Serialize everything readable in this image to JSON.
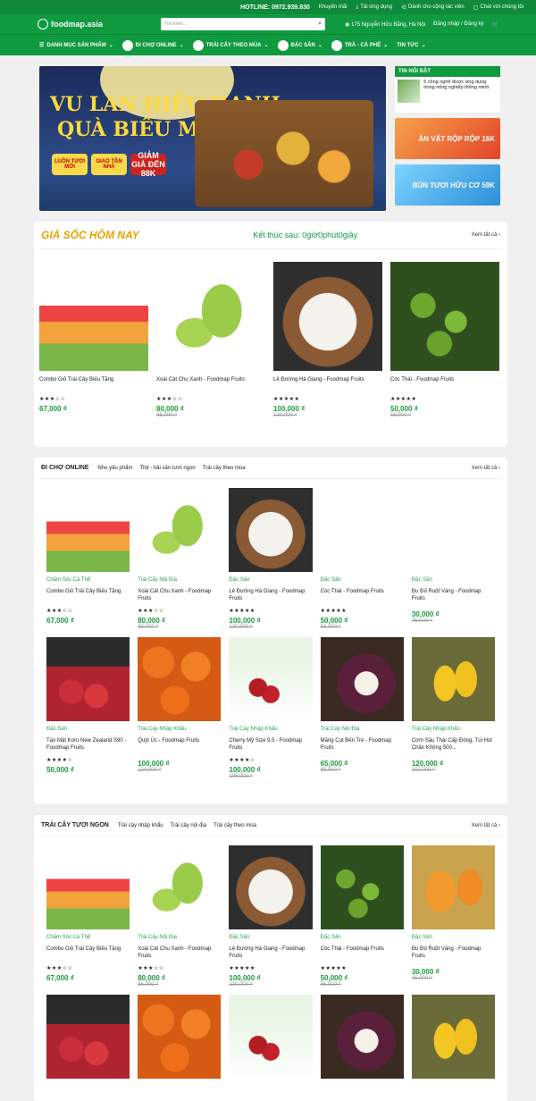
{
  "topbar": {
    "hotline": "HOTLINE: 0972.939.830",
    "links": [
      "Khuyến mãi",
      "Tải ứng dụng",
      "Dành cho cộng tác viên",
      "Chat với chúng tôi"
    ]
  },
  "header": {
    "logo": "foodmap.asia",
    "search_placeholder": "Tìm kiếm...",
    "address": "175 Nguyễn Hữu Bằng, Hà Nội",
    "account": "Đăng nhập / Đăng ký"
  },
  "nav": [
    "DANH MỤC SẢN PHẨM",
    "ĐI CHỢ ONLINE",
    "TRÁI CÂY THEO MÙA",
    "ĐẶC SẢN",
    "TRÀ - CÀ PHÊ",
    "TIN TỨC"
  ],
  "banner": {
    "title1": "VU LAN HIẾU HẠNH",
    "title2": "QUÀ BIẾU MẸ CHA",
    "badge1": "LUÔN TƯƠI MỚI",
    "badge2": "GIAO TẬN NHÀ",
    "badge3": "GIẢM GIÁ ĐẾN 88K"
  },
  "side": {
    "heading": "TIN NỔI BẬT",
    "news": "5 công nghệ được ứng dụng trong nông nghiệp thông minh",
    "ban1": "ĂN VẶT RỘP RỘP 16K",
    "ban2": "BÚN TƯƠI HỮU CƠ 59K"
  },
  "flash": {
    "title": "GIÁ SỐC HÔM NAY",
    "countdown": "Kết thúc sau: 0giờ0phút0giây",
    "more": "Xem tất cả ›",
    "items": [
      {
        "name": "Combo Giỏ Trái Cây Biếu Tặng",
        "stars": "★★★☆☆",
        "price": "67,000 ₫",
        "old": "",
        "img": "i-basket"
      },
      {
        "name": "Xoài Cát Chu Xanh - Foodmap Fruits",
        "stars": "★★★☆☆",
        "price": "80,000 ₫",
        "old": "86,000 ₫",
        "img": "i-mango"
      },
      {
        "name": "Lê Đường Hà Giang - Foodmap Fruits",
        "stars": "★★★★★",
        "price": "100,000 ₫",
        "old": "120,000 ₫",
        "img": "i-lychee"
      },
      {
        "name": "Cóc Thái - Foodmap Fruits",
        "stars": "★★★★★",
        "price": "50,000 ₫",
        "old": "56,000 ₫",
        "img": "i-coc"
      }
    ]
  },
  "online": {
    "title": "ĐI CHỢ ONLINE",
    "tabs": [
      "Nhu yếu phẩm",
      "Thịt - hải sản tươi ngon",
      "Trái cây theo mùa"
    ],
    "more": "Xem tất cả ›",
    "row1": [
      {
        "cat": "Chăm Sóc Cá Thể",
        "name": "Combo Giỏ Trái Cây Biếu Tặng",
        "stars": "★★★☆☆",
        "price": "67,000 ₫",
        "old": "",
        "img": "i-basket"
      },
      {
        "cat": "Trái Cây Nội Địa",
        "name": "Xoài Cát Chu Xanh - Foodmap Fruits",
        "stars": "★★★☆☆",
        "price": "80,000 ₫",
        "old": "86,000 ₫",
        "img": "i-mango"
      },
      {
        "cat": "Đặc Sản",
        "name": "Lê Đường Hà Giang - Foodmap Fruits",
        "stars": "★★★★★",
        "price": "100,000 ₫",
        "old": "120,000 ₫",
        "img": "i-lychee"
      },
      {
        "cat": "Đặc Sản",
        "name": "Cóc Thái - Foodmap Fruits",
        "stars": "★★★★★",
        "price": "50,000 ₫",
        "old": "56,000 ₫",
        "img": "i-blank"
      },
      {
        "cat": "Đặc Sản",
        "name": "Đu Đủ Ruột Vàng - Foodmap Fruits",
        "stars": "",
        "price": "30,000 ₫",
        "old": "45,000 ₫",
        "img": "i-blank"
      }
    ],
    "row2": [
      {
        "cat": "Đặc Sản",
        "name": "Táo Mật Koru New Zealand S90 - Foodmap Fruits",
        "stars": "★★★★☆",
        "price": "50,000 ₫",
        "old": "",
        "img": "i-apple"
      },
      {
        "cat": "Trái Cây Nhập Khẩu",
        "name": "Quýt Úc - Foodmap Fruits",
        "stars": "",
        "price": "100,000 ₫",
        "old": "120,000 ₫",
        "img": "i-orange"
      },
      {
        "cat": "Trái Cây Nhập Khẩu",
        "name": "Cherry Mỹ Size 9.5 - Foodmap Fruits",
        "stars": "★★★★☆",
        "price": "100,000 ₫",
        "old": "105,000 ₫",
        "img": "i-cherry"
      },
      {
        "cat": "Trái Cây Nội Địa",
        "name": "Măng Cụt Bến Tre - Foodmap Fruits",
        "stars": "",
        "price": "65,000 ₫",
        "old": "85,000 ₫",
        "img": "i-mang"
      },
      {
        "cat": "Trái Cây Nhập Khẩu",
        "name": "Cơm Sầu Thái Cấp Đông, Túi Hút Chân Không 500...",
        "stars": "",
        "price": "120,000 ₫",
        "old": "150,000 ₫",
        "img": "i-durian"
      }
    ]
  },
  "fresh": {
    "title": "TRÁI CÂY TƯƠI NGON",
    "tabs": [
      "Trái cây nhập khẩu",
      "Trái cây nội địa",
      "Trái cây theo mùa"
    ],
    "more": "Xem tất cả ›",
    "row1": [
      {
        "cat": "Chăm Sóc Cá Thể",
        "name": "Combo Giỏ Trái Cây Biếu Tặng",
        "stars": "★★★☆☆",
        "price": "67,000 ₫",
        "old": "",
        "img": "i-basket"
      },
      {
        "cat": "Trái Cây Nội Địa",
        "name": "Xoài Cát Chu Xanh - Foodmap Fruits",
        "stars": "★★★☆☆",
        "price": "80,000 ₫",
        "old": "86,000 ₫",
        "img": "i-mango"
      },
      {
        "cat": "Đặc Sản",
        "name": "Lê Đường Hà Giang - Foodmap Fruits",
        "stars": "★★★★★",
        "price": "100,000 ₫",
        "old": "120,000 ₫",
        "img": "i-lychee"
      },
      {
        "cat": "Đặc Sản",
        "name": "Cóc Thái - Foodmap Fruits",
        "stars": "★★★★★",
        "price": "50,000 ₫",
        "old": "56,000 ₫",
        "img": "i-coc"
      },
      {
        "cat": "Đặc Sản",
        "name": "Đu Đủ Ruột Vàng - Foodmap Fruits",
        "stars": "",
        "price": "30,000 ₫",
        "old": "45,000 ₫",
        "img": "i-papaya"
      }
    ],
    "row2": [
      {
        "img": "i-apple"
      },
      {
        "img": "i-orange"
      },
      {
        "img": "i-cherry"
      },
      {
        "img": "i-mang"
      },
      {
        "img": "i-durian"
      }
    ]
  }
}
